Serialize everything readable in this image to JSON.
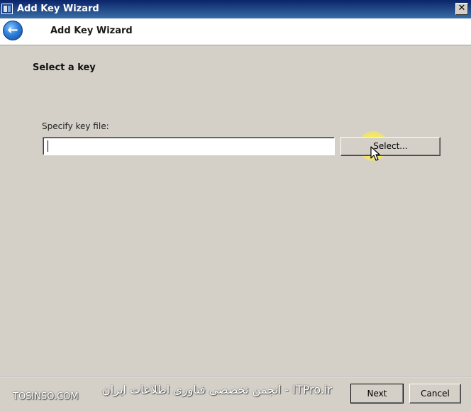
{
  "window": {
    "title": "Add Key Wizard",
    "close_glyph": "✕"
  },
  "header": {
    "back_glyph": "←",
    "title": "Add Key Wizard"
  },
  "page": {
    "section_title": "Select a key",
    "field_label": "Specify key file:",
    "key_file_value": "",
    "select_button": "Select..."
  },
  "footer": {
    "next_button": "Next",
    "cancel_button": "Cancel"
  },
  "watermark": {
    "left": "TOSINSO.COM",
    "center": "انجمن تخصصی فناوری اطلاعات ایران - ITPro.ir"
  },
  "colors": {
    "titlebar": "#0a246a",
    "face": "#d4d0c8",
    "back_button": "#2f7fd8"
  },
  "icons": {
    "app": "app-window-icon",
    "back": "back-arrow-icon",
    "close": "close-icon",
    "cursor": "mouse-pointer-icon"
  }
}
